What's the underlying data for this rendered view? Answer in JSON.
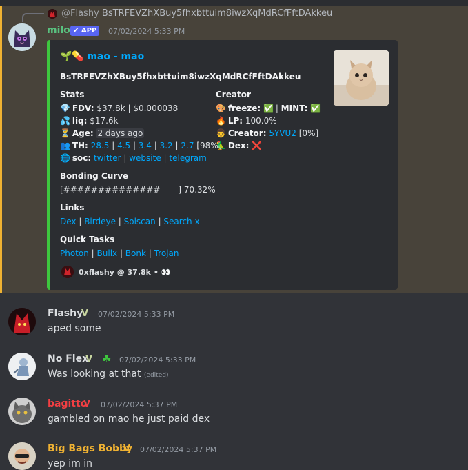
{
  "reply": {
    "user": "@Flashy",
    "text": "BsTRFEVZhXBuy5fhxbttuim8iwzXqMdRCfFftDAkkeu"
  },
  "main_message": {
    "username": "milo",
    "app_tag": "APP",
    "timestamp": "07/02/2024 5:33 PM",
    "embed": {
      "title": "mao - mao",
      "title_emoji": "🌱💊",
      "address": "BsTRFEVZhXBuy5fhxbttuim8iwzXqMdRCfFftDAkkeu",
      "stats": {
        "header": "Stats",
        "fdv_label": "FDV:",
        "fdv_value": "$37.8k | $0.000038",
        "liq_label": "liq:",
        "liq_value": "$17.6k",
        "age_label": "Age:",
        "age_value": "2 days ago",
        "th_label": "TH:",
        "th_values": [
          "28.5",
          "4.5",
          "3.4",
          "3.2",
          "2.7"
        ],
        "th_total": "[98%]",
        "soc_label": "soc:",
        "soc_links": [
          "twitter",
          "website",
          "telegram"
        ]
      },
      "creator": {
        "header": "Creator",
        "freeze_label": "freeze:",
        "mint_label": "MINT:",
        "lp_label": "LP:",
        "lp_value": "100.0%",
        "creator_label": "Creator:",
        "creator_value": "5YVU2",
        "creator_pct": "[0%]",
        "dex_label": "Dex:"
      },
      "bonding": {
        "header": "Bonding Curve",
        "text": "[##############------] 70.32%"
      },
      "links": {
        "header": "Links",
        "items": [
          "Dex",
          "Birdeye",
          "Solscan",
          "Search x"
        ]
      },
      "quick_tasks": {
        "header": "Quick Tasks",
        "items": [
          "Photon",
          "Bullx",
          "Bonk",
          "Trojan"
        ]
      },
      "footer": "0xflashy @ 37.8k • 👀"
    }
  },
  "messages": [
    {
      "username": "Flashy",
      "timestamp": "07/02/2024 5:33 PM",
      "text": "aped some",
      "name_color": "#dbdee1"
    },
    {
      "username": "No Flex",
      "timestamp": "07/02/2024 5:33 PM",
      "text": "Was looking at that",
      "edited": "(edited)",
      "name_color": "#dbdee1"
    },
    {
      "username": "bagitto",
      "timestamp": "07/02/2024 5:37 PM",
      "text": "gambled on mao he just paid dex",
      "name_color": "#f23f43"
    },
    {
      "username": "Big Bags Bobby",
      "timestamp": "07/02/2024 5:37 PM",
      "text": "yep im in",
      "name_color": "#f0b232"
    }
  ],
  "colors": {
    "accent": "#3ec73e",
    "link": "#00a8fc",
    "highlight": "#48433a",
    "app_badge": "#5865f2"
  }
}
